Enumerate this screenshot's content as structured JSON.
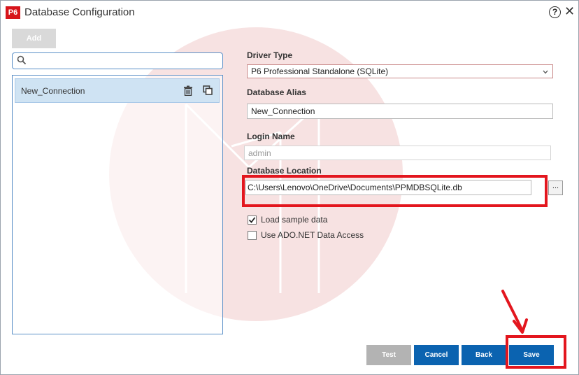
{
  "window": {
    "logo": "P6",
    "title": "Database Configuration",
    "help_symbol": "?",
    "close_symbol": "✕"
  },
  "toolbar": {
    "add_label": "Add"
  },
  "search": {
    "value": "",
    "placeholder": ""
  },
  "connections": [
    {
      "label": "New_Connection"
    }
  ],
  "form": {
    "driver_type_label": "Driver Type",
    "driver_type_value": "P6 Professional Standalone (SQLite)",
    "alias_label": "Database Alias",
    "alias_value": "New_Connection",
    "login_label": "Login Name",
    "login_value": "admin",
    "location_label": "Database Location",
    "location_value": "C:\\Users\\Lenovo\\OneDrive\\Documents\\PPMDBSQLite.db",
    "browse_label": "..."
  },
  "options": [
    {
      "label": "Load sample data",
      "checked": true
    },
    {
      "label": "Use ADO.NET Data Access",
      "checked": false
    }
  ],
  "buttons": {
    "test": "Test",
    "cancel": "Cancel",
    "back": "Back",
    "save": "Save"
  },
  "colors": {
    "primary": "#0b63b0",
    "disabled": "#b3b3b3",
    "highlight": "#e3161e",
    "logo": "#d7141a"
  },
  "icons": [
    "search-icon",
    "trash-icon",
    "copy-icon",
    "help-icon",
    "close-icon",
    "chevron-down-icon",
    "checkmark-icon"
  ]
}
